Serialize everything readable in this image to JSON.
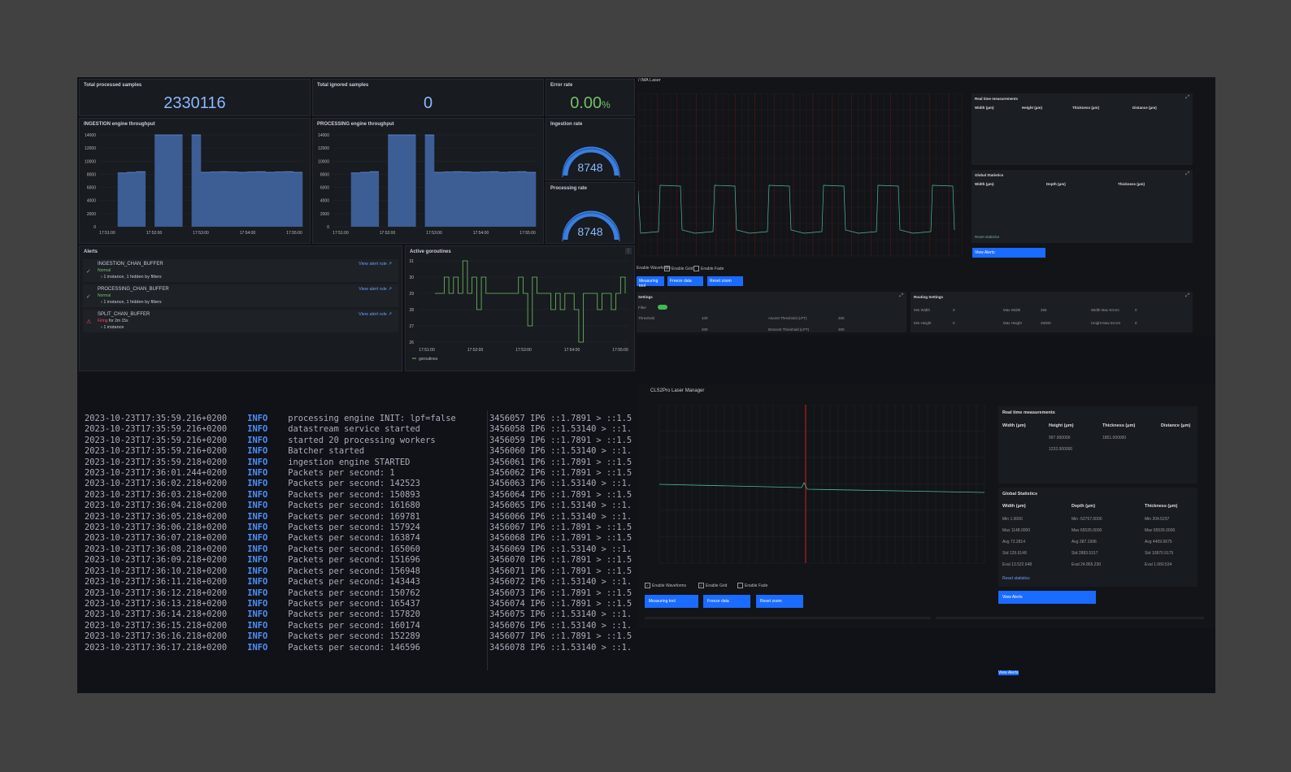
{
  "stats": {
    "processed": {
      "title": "Total processed samples",
      "value": "2330116",
      "color": "#8ab8ff"
    },
    "ignored": {
      "title": "Total ignored samples",
      "value": "0",
      "color": "#8ab8ff"
    },
    "error": {
      "title": "Error rate",
      "value": "0.00",
      "unit": "%",
      "color": "#73bf69"
    }
  },
  "ingestion_chart": {
    "title": "INGESTION engine throughput"
  },
  "processing_chart": {
    "title": "PROCESSING engine throughput"
  },
  "gauges": {
    "ingestion": {
      "title": "Ingestion rate",
      "value": "8748"
    },
    "processing": {
      "title": "Processing rate",
      "value": "8748"
    }
  },
  "alerts": {
    "title": "Alerts",
    "view_rule": "View alert rule",
    "items": [
      {
        "name": "INGESTION_CHAN_BUFFER",
        "state": "Normal",
        "instances": "1 instance, 1 hidden by filters"
      },
      {
        "name": "PROCESSING_CHAN_BUFFER",
        "state": "Normal",
        "instances": "1 instance, 1 hidden by filters"
      },
      {
        "name": "SPLIT_CHAN_BUFFER",
        "state": "Firing",
        "state_suffix": " for 2m 15s",
        "instances": "1 instance"
      }
    ]
  },
  "goroutines": {
    "title": "Active goroutines",
    "legend": "goroutines"
  },
  "chart_data": [
    {
      "type": "area",
      "title": "INGESTION engine throughput",
      "x": [
        "17:51:00",
        "17:52:00",
        "17:53:00",
        "17:54:00",
        "17:55:00"
      ],
      "ylim": [
        0,
        14000
      ],
      "yticks": [
        0,
        2000,
        4000,
        6000,
        8000,
        10000,
        12000,
        14000
      ],
      "values": [
        0,
        0,
        8200,
        8300,
        8400,
        0,
        14000,
        14000,
        14000,
        0,
        14000,
        8300,
        8350,
        8400,
        8350,
        8300,
        8350,
        8400,
        8300,
        8350,
        8400,
        8300
      ]
    },
    {
      "type": "area",
      "title": "PROCESSING engine throughput",
      "x": [
        "17:51:00",
        "17:52:00",
        "17:53:00",
        "17:54:00",
        "17:55:00"
      ],
      "ylim": [
        0,
        14000
      ],
      "yticks": [
        0,
        2000,
        4000,
        6000,
        8000,
        10000,
        12000,
        14000
      ],
      "values": [
        0,
        0,
        8200,
        8300,
        8400,
        0,
        14000,
        14000,
        14000,
        0,
        14000,
        8300,
        8350,
        8400,
        8350,
        8300,
        8350,
        8400,
        8300,
        8350,
        8400,
        8300
      ]
    },
    {
      "type": "line",
      "title": "Active goroutines",
      "x": [
        "17:51:00",
        "17:52:00",
        "17:53:00",
        "17:54:00",
        "17:55:00"
      ],
      "ylim": [
        26,
        31
      ],
      "yticks": [
        26,
        27,
        28,
        29,
        30,
        31
      ],
      "values": [
        29,
        29,
        30,
        29,
        30,
        29,
        31,
        29,
        30,
        28,
        30,
        29,
        29,
        29,
        29,
        29,
        29,
        29,
        30,
        29,
        27,
        30,
        29,
        29,
        29,
        28,
        29,
        28,
        29,
        29,
        28,
        26,
        29,
        29,
        29,
        28,
        29,
        29,
        28,
        29,
        30,
        29
      ]
    }
  ],
  "terminal_left": {
    "lines": [
      {
        "ts": "2023-10-23T17:35:59.216+0200",
        "lvl": "INFO",
        "msg": "processing engine INIT: lpf=false"
      },
      {
        "ts": "2023-10-23T17:35:59.216+0200",
        "lvl": "INFO",
        "msg": "datastream service started"
      },
      {
        "ts": "2023-10-23T17:35:59.216+0200",
        "lvl": "INFO",
        "msg": "started 20 processing workers"
      },
      {
        "ts": "2023-10-23T17:35:59.216+0200",
        "lvl": "INFO",
        "msg": "Batcher started"
      },
      {
        "ts": "2023-10-23T17:35:59.218+0200",
        "lvl": "INFO",
        "msg": "ingestion engine STARTED"
      },
      {
        "ts": "2023-10-23T17:36:01.244+0200",
        "lvl": "INFO",
        "msg": "Packets per second: 1"
      },
      {
        "ts": "2023-10-23T17:36:02.218+0200",
        "lvl": "INFO",
        "msg": "Packets per second: 142523"
      },
      {
        "ts": "2023-10-23T17:36:03.218+0200",
        "lvl": "INFO",
        "msg": "Packets per second: 150893"
      },
      {
        "ts": "2023-10-23T17:36:04.218+0200",
        "lvl": "INFO",
        "msg": "Packets per second: 161680"
      },
      {
        "ts": "2023-10-23T17:36:05.218+0200",
        "lvl": "INFO",
        "msg": "Packets per second: 169781"
      },
      {
        "ts": "2023-10-23T17:36:06.218+0200",
        "lvl": "INFO",
        "msg": "Packets per second: 157924"
      },
      {
        "ts": "2023-10-23T17:36:07.218+0200",
        "lvl": "INFO",
        "msg": "Packets per second: 163874"
      },
      {
        "ts": "2023-10-23T17:36:08.218+0200",
        "lvl": "INFO",
        "msg": "Packets per second: 165060"
      },
      {
        "ts": "2023-10-23T17:36:09.218+0200",
        "lvl": "INFO",
        "msg": "Packets per second: 151696"
      },
      {
        "ts": "2023-10-23T17:36:10.218+0200",
        "lvl": "INFO",
        "msg": "Packets per second: 156948"
      },
      {
        "ts": "2023-10-23T17:36:11.218+0200",
        "lvl": "INFO",
        "msg": "Packets per second: 143443"
      },
      {
        "ts": "2023-10-23T17:36:12.218+0200",
        "lvl": "INFO",
        "msg": "Packets per second: 150762"
      },
      {
        "ts": "2023-10-23T17:36:13.218+0200",
        "lvl": "INFO",
        "msg": "Packets per second: 165437"
      },
      {
        "ts": "2023-10-23T17:36:14.218+0200",
        "lvl": "INFO",
        "msg": "Packets per second: 157820"
      },
      {
        "ts": "2023-10-23T17:36:15.218+0200",
        "lvl": "INFO",
        "msg": "Packets per second: 160174"
      },
      {
        "ts": "2023-10-23T17:36:16.218+0200",
        "lvl": "INFO",
        "msg": "Packets per second: 152289"
      },
      {
        "ts": "2023-10-23T17:36:17.218+0200",
        "lvl": "INFO",
        "msg": "Packets per second: 146596"
      }
    ]
  },
  "terminal_right": {
    "lines": [
      "3456057 IP6 ::1.7891 > ::1.5",
      "3456058 IP6 ::1.53140 > ::1.",
      "3456059 IP6 ::1.7891 > ::1.5",
      "3456060 IP6 ::1.53140 > ::1.",
      "3456061 IP6 ::1.7891 > ::1.5",
      "3456062 IP6 ::1.7891 > ::1.5",
      "3456063 IP6 ::1.53140 > ::1.",
      "3456064 IP6 ::1.7891 > ::1.5",
      "3456065 IP6 ::1.53140 > ::1.",
      "3456066 IP6 ::1.53140 > ::1.",
      "3456067 IP6 ::1.7891 > ::1.5",
      "3456068 IP6 ::1.7891 > ::1.5",
      "3456069 IP6 ::1.53140 > ::1.",
      "3456070 IP6 ::1.7891 > ::1.5",
      "3456071 IP6 ::1.7891 > ::1.5",
      "3456072 IP6 ::1.53140 > ::1.",
      "3456073 IP6 ::1.7891 > ::1.5",
      "3456074 IP6 ::1.7891 > ::1.5",
      "3456075 IP6 ::1.53140 > ::1.",
      "3456076 IP6 ::1.53140 > ::1.",
      "3456077 IP6 ::1.7891 > ::1.5",
      "3456078 IP6 ::1.53140 > ::1."
    ]
  },
  "laser_top": {
    "title": "/ IMA Laser",
    "realtime": {
      "title": "Real time measurements",
      "headers": [
        "Width (μm)",
        "Height (μm)",
        "Thickness (μm)",
        "Distance (μm)"
      ]
    },
    "global": {
      "title": "Global Statistics",
      "headers": [
        "Width (μm)",
        "Depth (μm)",
        "Thickness (μm)"
      ]
    },
    "reset": "Reset statistics",
    "view_alerts": "View Alerts",
    "checks": [
      "Enable Waveforms",
      "Enable Grid",
      "Enable Fade"
    ],
    "buttons": [
      "Measuring tool",
      "Freeze data",
      "Reset zoom"
    ],
    "settings_title": "Settings",
    "routing_title": "Routing Settings",
    "settings_fields": [
      "Filter",
      "Threshold",
      "Ascent Threshold (LPT)",
      "Descent Threshold (LPT)"
    ],
    "routing_fields": [
      "Min Width",
      "Max Width",
      "Width Max Errors",
      "Min Height",
      "Max Height",
      "Height Max Errors"
    ],
    "routing_values": [
      "0",
      "256",
      "0",
      "0",
      "25000",
      "0"
    ],
    "settings_values": [
      "100",
      "200",
      "200",
      "200"
    ]
  },
  "laser_bottom": {
    "title": "CLS2Pro Laser Manager",
    "realtime": {
      "title": "Real time measurements",
      "headers": [
        "Width (μm)",
        "Height (μm)",
        "Thickness (μm)",
        "Distance (μm)"
      ],
      "row1": [
        "",
        "997.000000",
        "1851.000000",
        ""
      ],
      "row2": [
        "",
        "1232.000000",
        "",
        ""
      ]
    },
    "global": {
      "title": "Global Statistics",
      "headers": [
        "Width (μm)",
        "Depth (μm)",
        "Thickness (μm)"
      ],
      "rows": [
        [
          "Min 1.0000",
          "Min -52767.0000",
          "Min 204.5237"
        ],
        [
          "Max 1148.0000",
          "Max 65535.0000",
          "Max 65535.0000"
        ],
        [
          "Avg 72.2814",
          "Avg 387.1996",
          "Avg 4469.9675"
        ],
        [
          "Std 126.6148",
          "Std 2883.5317",
          "Std 10870.9175"
        ],
        [
          "Eval 13.522.648",
          "Eval 24.865.230",
          "Eval 1.060.534"
        ]
      ]
    },
    "reset": "Reset statistics",
    "view_alerts": "View Alerts",
    "checks": [
      "Enable Waveforms",
      "Enable Grid",
      "Enable Fade"
    ],
    "buttons": [
      "Measuring tool",
      "Freeze data",
      "Reset zoom"
    ]
  },
  "colors": {
    "bar": "#3d5d95",
    "bar_line": "#5f8fd8",
    "gauge": "#3a7fe0",
    "laser_line": "#4fb8a0",
    "red_line": "#b02020",
    "accent": "#1a6bff"
  }
}
